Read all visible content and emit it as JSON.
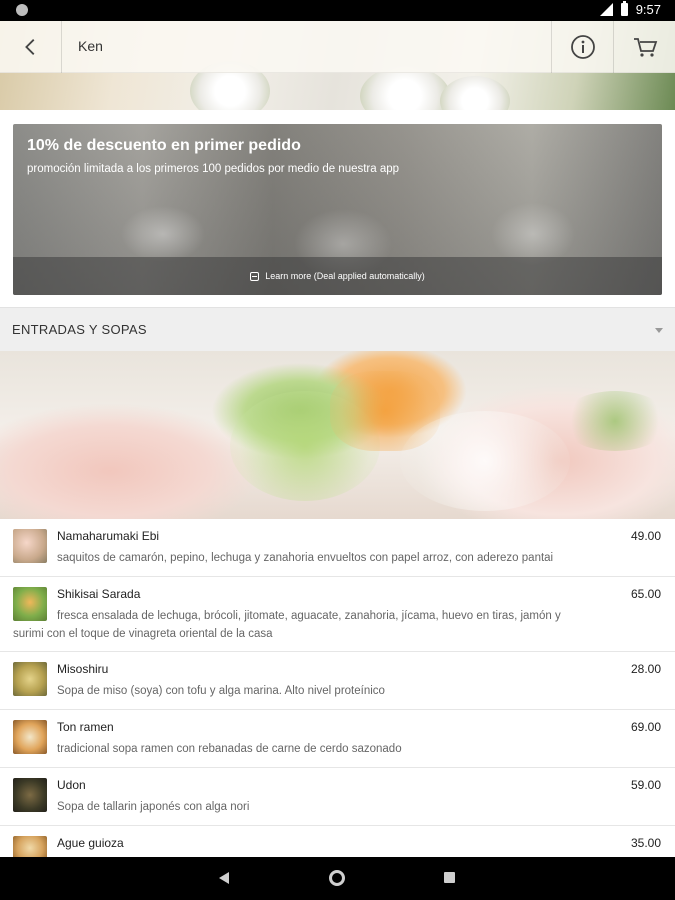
{
  "status_bar": {
    "time": "9:57"
  },
  "header": {
    "title": "Ken"
  },
  "promo": {
    "title": "10% de descuento en primer pedido",
    "subtitle": "promoción limitada a los primeros 100 pedidos por medio de nuestra app",
    "learn_more": "Learn more (Deal applied automatically)"
  },
  "section": {
    "title": "ENTRADAS Y SOPAS"
  },
  "menu": {
    "items": [
      {
        "name": "Namaharumaki Ebi",
        "price": "49.00",
        "description": "saquitos de camarón, pepino, lechuga y zanahoria envueltos con papel arroz, con aderezo pantai"
      },
      {
        "name": "Shikisai Sarada",
        "price": "65.00",
        "description_line1": "fresca ensalada de lechuga, brócoli, jitomate, aguacate, zanahoria, jícama, huevo en tiras, jamón y",
        "description_line2": "surimi con el toque de vinagreta oriental de la casa"
      },
      {
        "name": "Misoshiru",
        "price": "28.00",
        "description": "Sopa de miso (soya) con tofu y alga marina. Alto nivel proteínico"
      },
      {
        "name": "Ton ramen",
        "price": "69.00",
        "description": "tradicional sopa ramen con rebanadas de carne de cerdo sazonado"
      },
      {
        "name": "Udon",
        "price": "59.00",
        "description": "Sopa de tallarin japonés con alga nori"
      },
      {
        "name": "Ague guioza",
        "price": "35.00"
      }
    ]
  },
  "colors": {
    "status_bar": "#000000",
    "section_header_bg": "#efefef",
    "divider": "#e6e6e6"
  },
  "icons": [
    "back-arrow-icon",
    "info-icon",
    "cart-icon",
    "plus-square-icon",
    "chevron-down-icon"
  ]
}
